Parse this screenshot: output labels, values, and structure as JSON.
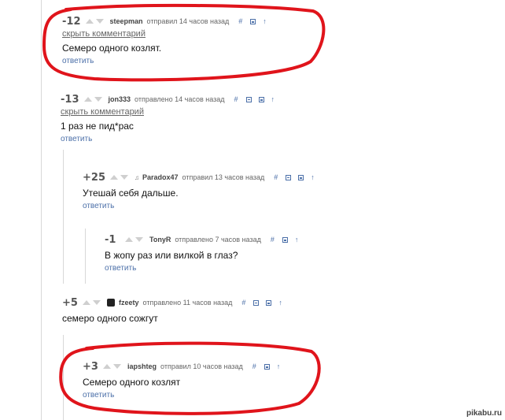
{
  "comments": [
    {
      "rating": "-12",
      "author": "steepman",
      "verb": "отправил",
      "time": "14 часов назад",
      "hide": "скрыть комментарий",
      "text": "Семеро одного козлят.",
      "reply": "ответить"
    },
    {
      "rating": "-13",
      "author": "jon333",
      "verb": "отправлено",
      "time": "14 часов назад",
      "hide": "скрыть комментарий",
      "text": "1 раз не пид*рас",
      "reply": "ответить"
    },
    {
      "rating": "+25",
      "author": "Paradox47",
      "verb": "отправил",
      "time": "13 часов назад",
      "text": "Утешай себя дальше.",
      "reply": "ответить"
    },
    {
      "rating": "-1",
      "author": "TonyR",
      "verb": "отправлено",
      "time": "7 часов назад",
      "text": "В жопу раз или вилкой в глаз?",
      "reply": "ответить"
    },
    {
      "rating": "+5",
      "author": "fzeety",
      "verb": "отправлено",
      "time": "11 часов назад",
      "text": "семеро одного сожгут"
    },
    {
      "rating": "+3",
      "author": "iapshteg",
      "verb": "отправил",
      "time": "10 часов назад",
      "text": "Семеро одного козлят",
      "reply": "ответить"
    }
  ],
  "icons": {
    "link": "#",
    "vote_up": "triangle-up",
    "vote_down": "triangle-down",
    "parent": "↑"
  },
  "colors": {
    "annotation": "#e0141b",
    "action": "#4b6fa8"
  },
  "watermark": "pikabu.ru"
}
